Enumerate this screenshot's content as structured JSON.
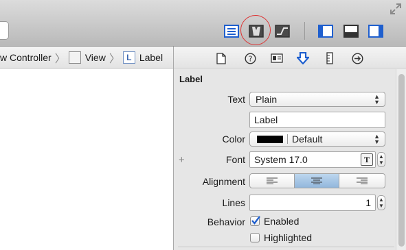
{
  "jumpbar": {
    "crumbs": [
      {
        "label": "w Controller",
        "icon": "none"
      },
      {
        "label": "View",
        "icon": "view-icon"
      },
      {
        "label": "Label",
        "icon": "label-icon",
        "icon_letter": "L"
      }
    ]
  },
  "inspector": {
    "section_title": "Label",
    "text": {
      "label": "Text",
      "popup_value": "Plain",
      "field_value": "Label"
    },
    "color": {
      "label": "Color",
      "value": "Default",
      "swatch": "#000000"
    },
    "font": {
      "label": "Font",
      "value": "System 17.0",
      "add_symbol": "+",
      "picker_glyph": "T"
    },
    "alignment": {
      "label": "Alignment",
      "selected": "center"
    },
    "lines": {
      "label": "Lines",
      "value": "1"
    },
    "behavior": {
      "label": "Behavior",
      "enabled": {
        "label": "Enabled",
        "checked": true
      },
      "highlighted": {
        "label": "Highlighted",
        "checked": false
      }
    }
  },
  "colors": {
    "accent": "#1f5fce",
    "highlight_ring": "#dd3333"
  }
}
